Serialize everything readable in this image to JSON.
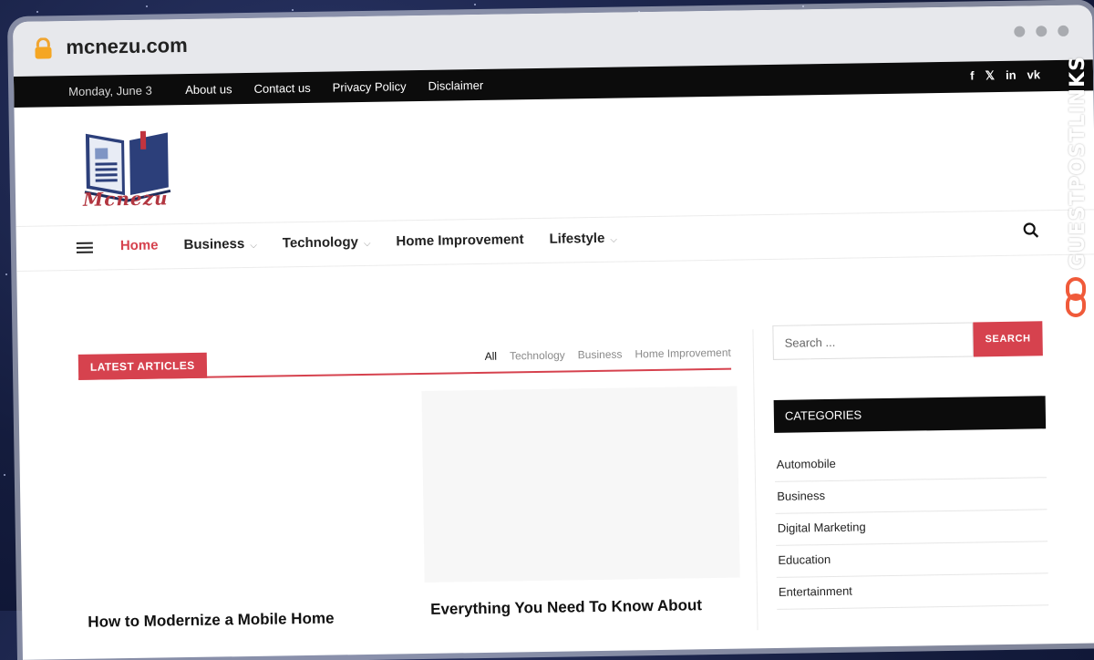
{
  "browser": {
    "url": "mcnezu.com"
  },
  "topbar": {
    "date": "Monday, June 3",
    "links": [
      "About us",
      "Contact us",
      "Privacy Policy",
      "Disclaimer"
    ],
    "social": [
      "f",
      "𝕏",
      "in",
      "vk"
    ]
  },
  "brand": {
    "logo_text": "Mcnezu",
    "accent": "#d6424e",
    "logo_blue": "#2c3f7a"
  },
  "nav": {
    "items": [
      {
        "label": "Home",
        "active": true,
        "dropdown": false
      },
      {
        "label": "Business",
        "active": false,
        "dropdown": true
      },
      {
        "label": "Technology",
        "active": false,
        "dropdown": true
      },
      {
        "label": "Home Improvement",
        "active": false,
        "dropdown": false
      },
      {
        "label": "Lifestyle",
        "active": false,
        "dropdown": true
      }
    ]
  },
  "main": {
    "section_label": "LATEST ARTICLES",
    "filters": [
      "All",
      "Technology",
      "Business",
      "Home Improvement"
    ],
    "cards": [
      {
        "title": "How to Modernize a Mobile Home"
      },
      {
        "title": "Everything You Need To Know About"
      }
    ]
  },
  "sidebar": {
    "search_placeholder": "Search ...",
    "search_button": "SEARCH",
    "categories_heading": "CATEGORIES",
    "categories": [
      "Automobile",
      "Business",
      "Digital Marketing",
      "Education",
      "Entertainment"
    ]
  },
  "watermark": {
    "text": "GUESTPOSTLINKS"
  }
}
